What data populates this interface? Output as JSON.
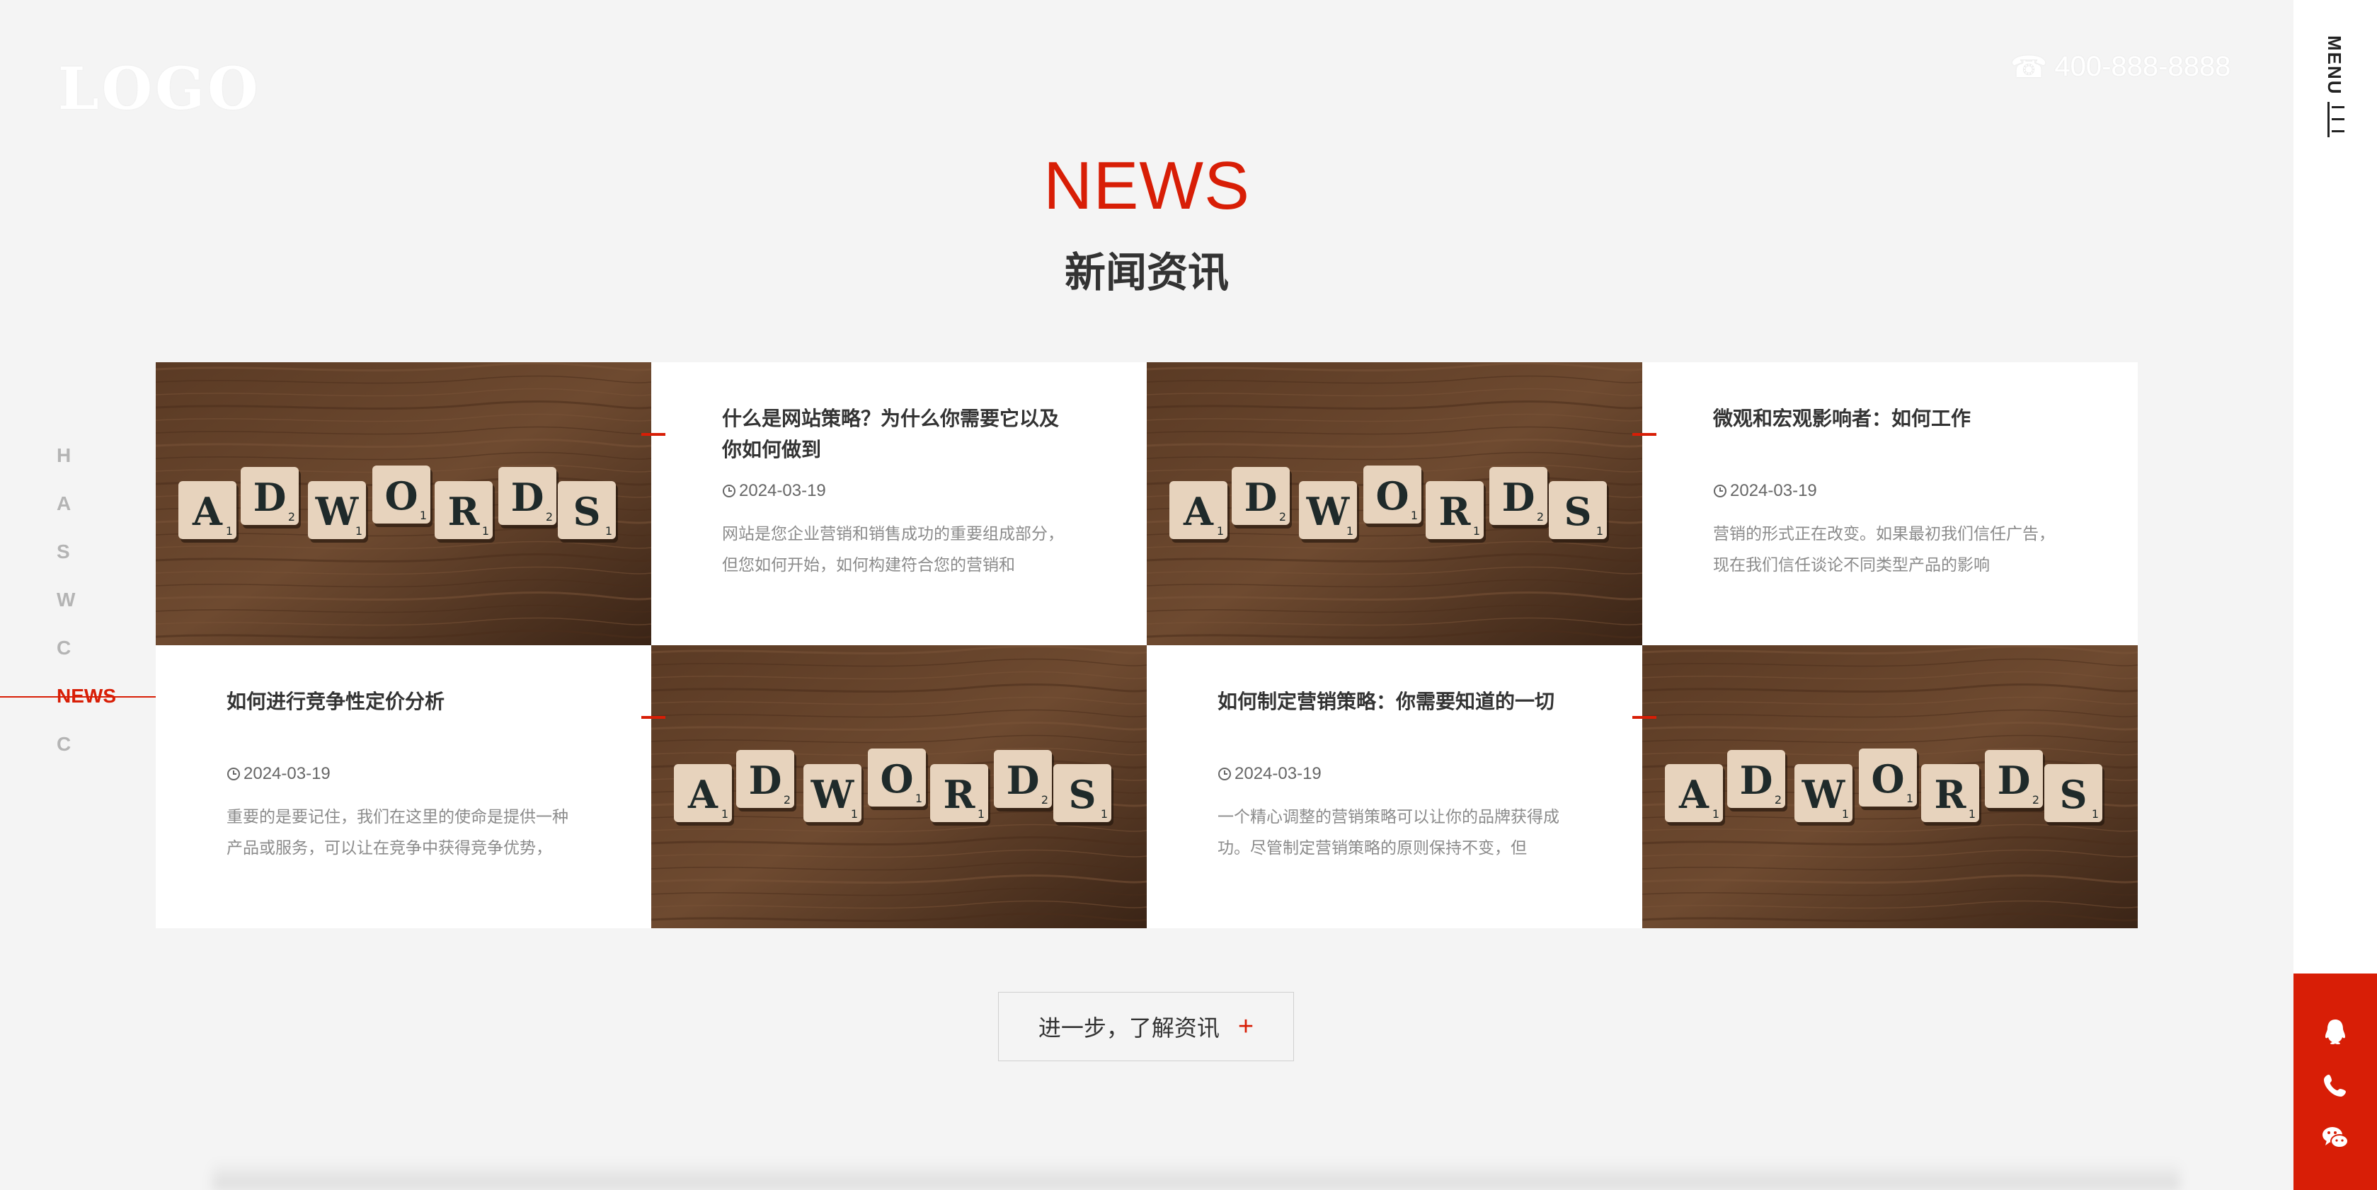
{
  "header": {
    "logo": "LOGO",
    "phone": "400-888-8888",
    "phone_icon": "phone-icon",
    "menu_label": "MENU"
  },
  "side_nav": {
    "items": [
      {
        "label": "H"
      },
      {
        "label": "A"
      },
      {
        "label": "S"
      },
      {
        "label": "W"
      },
      {
        "label": "C"
      },
      {
        "label": "NEWS",
        "active": true
      },
      {
        "label": "C"
      }
    ]
  },
  "section": {
    "title_en": "NEWS",
    "title_cn": "新闻资讯"
  },
  "news": [
    {
      "title": "什么是网站策略？为什么你需要它以及你如何做到",
      "date": "2024-03-19",
      "excerpt": "网站是您企业营销和销售成功的重要组成部分，但您如何开始，如何构建符合您的营销和"
    },
    {
      "title": "微观和宏观影响者：如何工作",
      "date": "2024-03-19",
      "excerpt": "营销的形式正在改变。如果最初我们信任广告，现在我们信任谈论不同类型产品的影响"
    },
    {
      "title": "如何进行竞争性定价分析",
      "date": "2024-03-19",
      "excerpt": "重要的是要记住，我们在这里的使命是提供一种产品或服务，可以让在竞争中获得竞争优势，"
    },
    {
      "title": "如何制定营销策略：你需要知道的一切",
      "date": "2024-03-19",
      "excerpt": "一个精心调整的营销策略可以让你的品牌获得成功。尽管制定营销策略的原则保持不变，但"
    }
  ],
  "tiles": {
    "letters": [
      "A",
      "D",
      "W",
      "O",
      "R",
      "D",
      "S"
    ],
    "scores": [
      "1",
      "2",
      "1",
      "1",
      "1",
      "2",
      "1"
    ]
  },
  "more_button": {
    "label": "进一步，了解资讯",
    "icon": "plus-icon"
  },
  "contact_icons": [
    "qq-icon",
    "phone-icon",
    "wechat-icon"
  ],
  "colors": {
    "accent": "#d81e06",
    "background": "#f4f4f4",
    "card": "#ffffff"
  }
}
